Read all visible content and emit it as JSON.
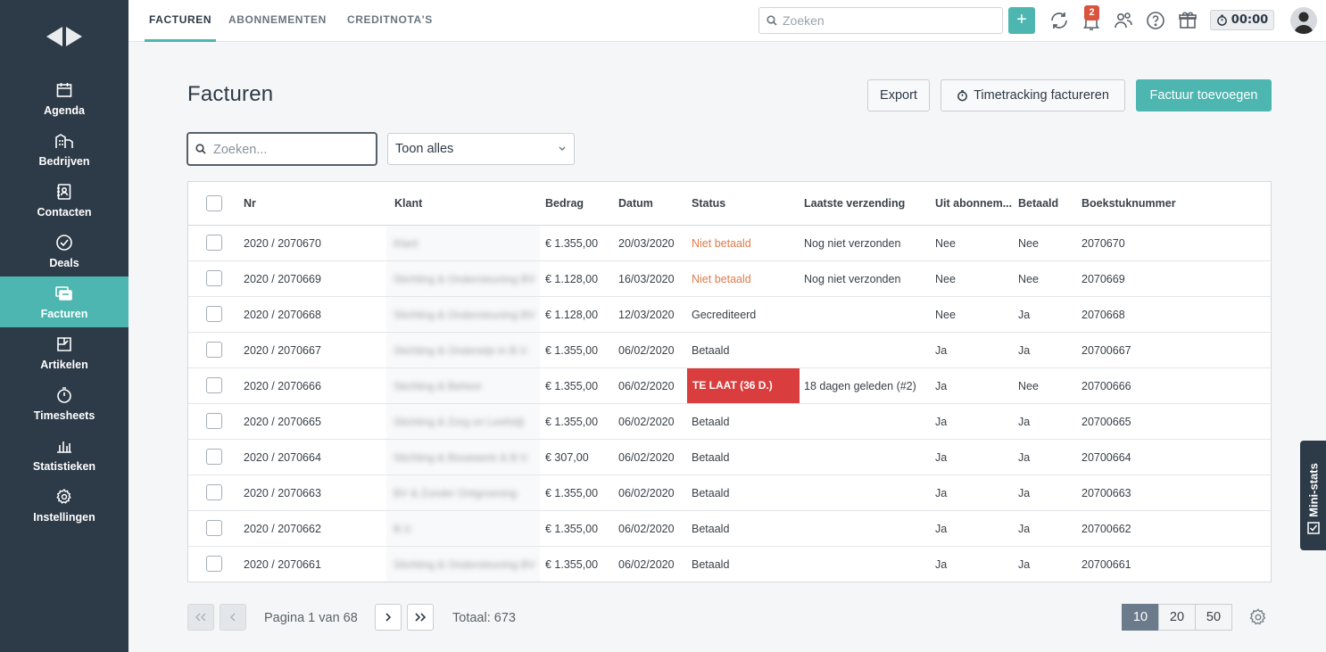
{
  "sidebar": {
    "items": [
      {
        "label": "Agenda",
        "icon": "calendar-icon"
      },
      {
        "label": "Bedrijven",
        "icon": "buildings-icon"
      },
      {
        "label": "Contacten",
        "icon": "contacts-icon"
      },
      {
        "label": "Deals",
        "icon": "check-circle-icon"
      },
      {
        "label": "Facturen",
        "icon": "invoice-icon",
        "active": true
      },
      {
        "label": "Artikelen",
        "icon": "articles-icon"
      },
      {
        "label": "Timesheets",
        "icon": "stopwatch-icon"
      },
      {
        "label": "Statistieken",
        "icon": "bar-chart-icon"
      },
      {
        "label": "Instellingen",
        "icon": "gear-icon"
      }
    ]
  },
  "topbar": {
    "tabs": [
      "FACTUREN",
      "ABONNEMENTEN",
      "CREDITNOTA'S"
    ],
    "search_placeholder": "Zoeken",
    "add_label": "+",
    "notification_count": "2",
    "timer": "00:00"
  },
  "page": {
    "title": "Facturen",
    "export_label": "Export",
    "timetracking_label": "Timetracking factureren",
    "add_invoice_label": "Factuur toevoegen",
    "search_placeholder": "Zoeken...",
    "filter_value": "Toon alles"
  },
  "table": {
    "headers": [
      "Nr",
      "Klant",
      "Bedrag",
      "Datum",
      "Status",
      "Laatste verzending",
      "Uit abonnem...",
      "Betaald",
      "Boekstuknummer"
    ],
    "rows": [
      {
        "nr": "2020 / 2070670",
        "klant": "Klant",
        "bedrag": "€ 1.355,00",
        "datum": "20/03/2020",
        "status": "Niet betaald",
        "status_type": "unpaid",
        "verzending": "Nog niet verzonden",
        "abonnement": "Nee",
        "betaald": "Nee",
        "boekstuk": "2070670"
      },
      {
        "nr": "2020 / 2070669",
        "klant": "Stichting & Ondersteuning BV",
        "bedrag": "€ 1.128,00",
        "datum": "16/03/2020",
        "status": "Niet betaald",
        "status_type": "unpaid",
        "verzending": "Nog niet verzonden",
        "abonnement": "Nee",
        "betaald": "Nee",
        "boekstuk": "2070669"
      },
      {
        "nr": "2020 / 2070668",
        "klant": "Stichting & Ondersteuning BV",
        "bedrag": "€ 1.128,00",
        "datum": "12/03/2020",
        "status": "Gecrediteerd",
        "status_type": "normal",
        "verzending": "",
        "abonnement": "Nee",
        "betaald": "Ja",
        "boekstuk": "2070668"
      },
      {
        "nr": "2020 / 2070667",
        "klant": "Stichting & Onderwijs in B.V.",
        "bedrag": "€ 1.355,00",
        "datum": "06/02/2020",
        "status": "Betaald",
        "status_type": "normal",
        "verzending": "",
        "abonnement": "Ja",
        "betaald": "Ja",
        "boekstuk": "20700667"
      },
      {
        "nr": "2020 / 2070666",
        "klant": "Stichting & Beheer",
        "bedrag": "€ 1.355,00",
        "datum": "06/02/2020",
        "status": "TE LAAT (36 D.)",
        "status_type": "late",
        "verzending": "18 dagen geleden (#2)",
        "abonnement": "Ja",
        "betaald": "Nee",
        "boekstuk": "20700666"
      },
      {
        "nr": "2020 / 2070665",
        "klant": "Stichting & Zorg en Leefstijl",
        "bedrag": "€ 1.355,00",
        "datum": "06/02/2020",
        "status": "Betaald",
        "status_type": "normal",
        "verzending": "",
        "abonnement": "Ja",
        "betaald": "Ja",
        "boekstuk": "20700665"
      },
      {
        "nr": "2020 / 2070664",
        "klant": "Stichting & Bouwwerk & B.V.",
        "bedrag": "€ 307,00",
        "datum": "06/02/2020",
        "status": "Betaald",
        "status_type": "normal",
        "verzending": "",
        "abonnement": "Ja",
        "betaald": "Ja",
        "boekstuk": "20700664"
      },
      {
        "nr": "2020 / 2070663",
        "klant": "BV & Zonder Ontgroening",
        "bedrag": "€ 1.355,00",
        "datum": "06/02/2020",
        "status": "Betaald",
        "status_type": "normal",
        "verzending": "",
        "abonnement": "Ja",
        "betaald": "Ja",
        "boekstuk": "20700663"
      },
      {
        "nr": "2020 / 2070662",
        "klant": "B.V.",
        "bedrag": "€ 1.355,00",
        "datum": "06/02/2020",
        "status": "Betaald",
        "status_type": "normal",
        "verzending": "",
        "abonnement": "Ja",
        "betaald": "Ja",
        "boekstuk": "20700662"
      },
      {
        "nr": "2020 / 2070661",
        "klant": "Stichting & Ondersteuning BV",
        "bedrag": "€ 1.355,00",
        "datum": "06/02/2020",
        "status": "Betaald",
        "status_type": "normal",
        "verzending": "",
        "abonnement": "Ja",
        "betaald": "Ja",
        "boekstuk": "20700661"
      }
    ]
  },
  "pagination": {
    "page_text": "Pagina 1 van 68",
    "total_text": "Totaal: 673",
    "sizes": [
      "10",
      "20",
      "50"
    ],
    "selected_size": "10"
  },
  "ministats_label": "Mini-stats",
  "colors": {
    "sidebar": "#2d3a47",
    "accent": "#4db6b0",
    "late": "#d93d3d",
    "unpaid": "#e07b4a"
  }
}
